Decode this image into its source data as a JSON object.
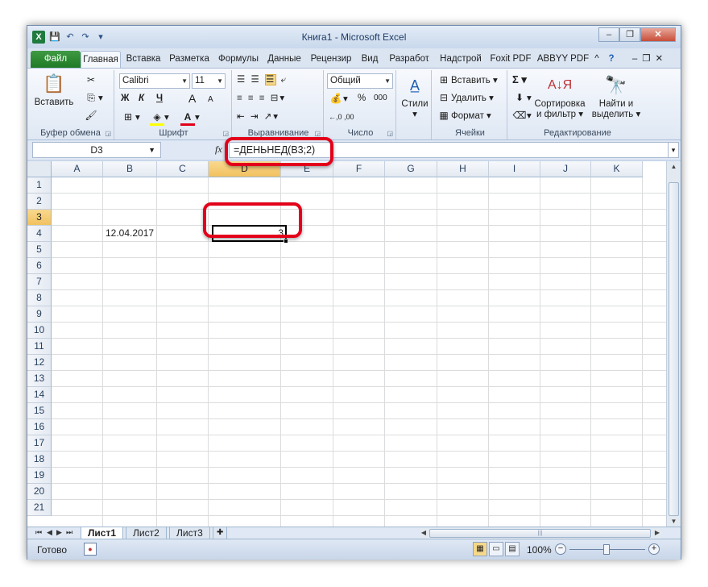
{
  "window": {
    "title": "Книга1  -  Microsoft Excel",
    "app_icon_letter": "X",
    "controls": {
      "minimize": "–",
      "restore": "❐",
      "close": "✕"
    }
  },
  "qat": {
    "save": "💾",
    "undo": "↶",
    "redo": "↷",
    "customize": "▾"
  },
  "tabs": [
    {
      "label": "Файл"
    },
    {
      "label": "Главная"
    },
    {
      "label": "Вставка"
    },
    {
      "label": "Разметка"
    },
    {
      "label": "Формулы"
    },
    {
      "label": "Данные"
    },
    {
      "label": "Рецензир"
    },
    {
      "label": "Вид"
    },
    {
      "label": "Разрабоτ"
    },
    {
      "label": "Надстрой"
    },
    {
      "label": "Foxit PDF"
    },
    {
      "label": "ABBYY PDF"
    }
  ],
  "ribbon": {
    "clipboard": {
      "paste": "Вставить",
      "label": "Буфер обмена"
    },
    "font": {
      "name": "Calibri",
      "size": "11",
      "bold": "Ж",
      "italic": "К",
      "underline": "Ч",
      "grow": "A",
      "shrink": "A",
      "label": "Шрифт"
    },
    "alignment": {
      "label": "Выравнивание"
    },
    "number": {
      "format": "Общий",
      "percent": "%",
      "thousands": "000",
      "label": "Число"
    },
    "styles": {
      "label": "Стили"
    },
    "cells": {
      "insert": "Вставить",
      "delete": "Удалить",
      "format": "Формат",
      "label": "Ячейки"
    },
    "editing": {
      "sum": "Σ",
      "sort": "Сортировка",
      "sort2": "и фильтр",
      "find": "Найти и",
      "find2": "выделить",
      "label": "Редактирование"
    }
  },
  "formula_bar": {
    "name_box": "D3",
    "fx": "fx",
    "formula": "=ДЕНЬНЕД(B3;2)"
  },
  "columns": [
    "A",
    "B",
    "C",
    "D",
    "E",
    "F",
    "G",
    "H",
    "I",
    "J",
    "K"
  ],
  "rows": [
    "1",
    "2",
    "3",
    "4",
    "5",
    "6",
    "7",
    "8",
    "9",
    "10",
    "11",
    "12",
    "13",
    "14",
    "15",
    "16",
    "17",
    "18",
    "19",
    "20",
    "21"
  ],
  "cells": {
    "B3": "12.04.2017",
    "D3": "3"
  },
  "sheets": [
    "Лист1",
    "Лист2",
    "Лист3"
  ],
  "status": {
    "ready": "Готово",
    "zoom": "100%"
  },
  "highlight_color": "#e3001a",
  "accent_color": "#1f7a25"
}
